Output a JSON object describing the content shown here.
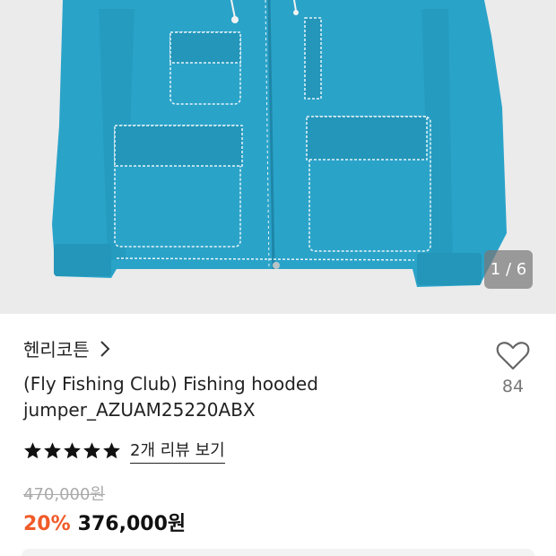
{
  "gallery": {
    "image_alt_icon": "jacket-photo",
    "counter": "1 / 6"
  },
  "product": {
    "brand": "헨리코튼",
    "title": "(Fly Fishing Club) Fishing hooded jumper_AZUAM25220ABX",
    "wish_count": "84",
    "rating_stars": 5,
    "review_link": "2개 리뷰 보기",
    "original_price": "470,000원",
    "discount": "20%",
    "price": "376,000원"
  },
  "colors": {
    "jacket": "#2aa3c9",
    "discount": "#f05a28",
    "background_image": "#ebebeb"
  }
}
